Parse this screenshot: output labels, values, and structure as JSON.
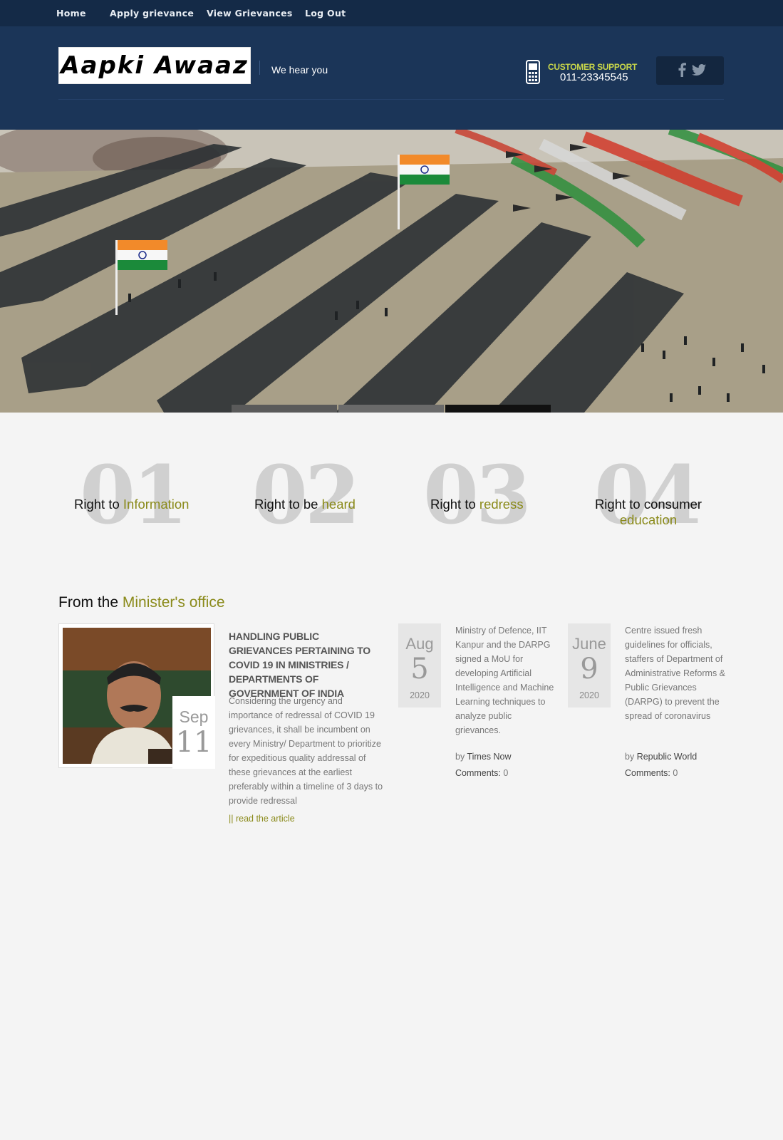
{
  "nav": {
    "home": "Home",
    "apply": "Apply grievance",
    "view": "View Grievances",
    "logout": "Log Out"
  },
  "header": {
    "logo": "Aapki Awaaz",
    "tagline": "We hear you",
    "support_title": "CUSTOMER SUPPORT",
    "support_number": "011-23345545"
  },
  "rights": [
    {
      "num": "01",
      "prefix": "Right to ",
      "highlight": "Information"
    },
    {
      "num": "02",
      "prefix": "Right to be ",
      "highlight": "heard"
    },
    {
      "num": "03",
      "prefix": "Right to ",
      "highlight": "redress"
    },
    {
      "num": "04",
      "prefix": "Right to consumer",
      "highlight": "education"
    }
  ],
  "minister": {
    "title_prefix": "From the ",
    "title_highlight": "Minister's office",
    "featured": {
      "month": "Sep",
      "day": "11",
      "title": "HANDLING PUBLIC GRIEVANCES PERTAINING TO COVID 19 IN MINISTRIES / DEPARTMENTS OF GOVERNMENT OF INDIA",
      "body": "Considering the urgency and importance of redressal of COVID 19 grievances, it shall be incumbent on every Ministry/ Department to prioritize for expeditious quality addressal of these grievances at the earliest preferably within a timeline of 3 days to provide redressal",
      "link": "|| read the article"
    },
    "news": [
      {
        "month": "Aug",
        "day": "5",
        "year": "2020",
        "body": "Ministry of Defence, IIT Kanpur and the DARPG signed a MoU for developing Artificial Intelligence and Machine Learning techniques to analyze public grievances.",
        "by_label": "by ",
        "source": "Times Now",
        "comments_label": "Comments:",
        "comments": "0"
      },
      {
        "month": "June",
        "day": "9",
        "year": "2020",
        "body": "Centre issued fresh guidelines for officials, staffers of Department of Administrative Reforms & Public Grievances (DARPG) to prevent the spread of coronavirus",
        "by_label": "by ",
        "source": "Republic World",
        "comments_label": "Comments:",
        "comments": "0"
      }
    ]
  },
  "slider": {
    "slides": 3,
    "active": 3
  },
  "colors": {
    "nav_bg": "#142a47",
    "header_bg": "#1b3558",
    "accent": "#8a8a1a",
    "support_accent": "#c8d64a"
  },
  "icons": [
    "phone-icon",
    "facebook-icon",
    "twitter-icon"
  ]
}
